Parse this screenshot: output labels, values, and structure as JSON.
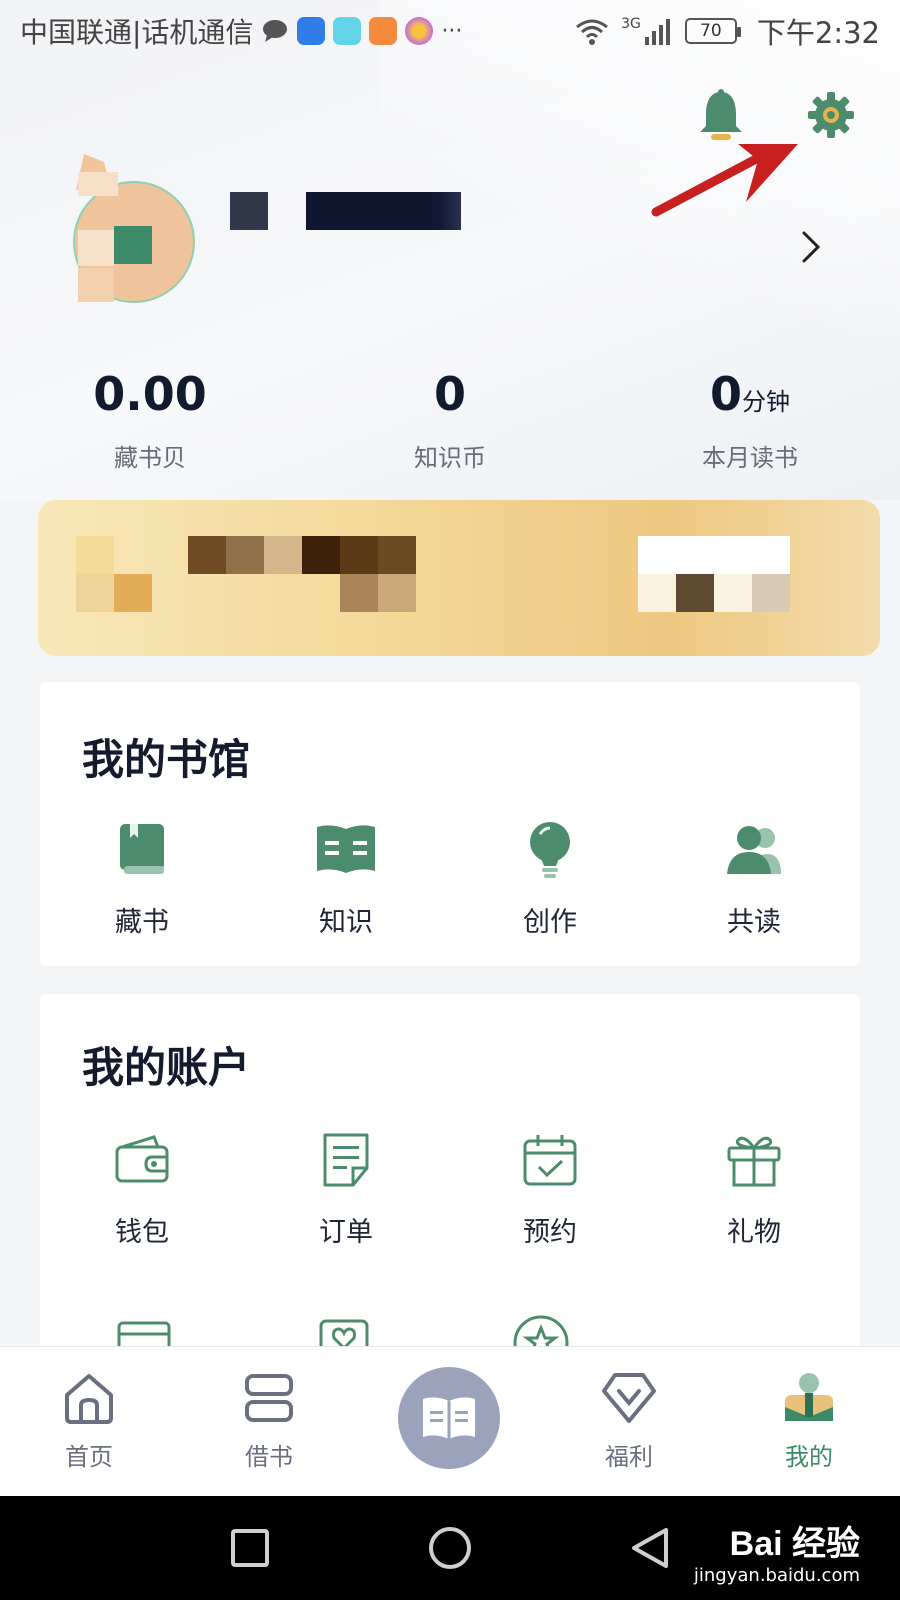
{
  "status_bar": {
    "carrier": "中国联通|话机通信",
    "more": "···",
    "network": "3G",
    "battery": "70",
    "time": "下午2:32"
  },
  "stats": [
    {
      "value": "0.00",
      "unit": "",
      "label": "藏书贝"
    },
    {
      "value": "0",
      "unit": "",
      "label": "知识币"
    },
    {
      "value": "0",
      "unit": "分钟",
      "label": "本月读书"
    }
  ],
  "library": {
    "title": "我的书馆",
    "items": [
      {
        "label": "藏书",
        "icon": "book-icon"
      },
      {
        "label": "知识",
        "icon": "open-book-icon"
      },
      {
        "label": "创作",
        "icon": "lightbulb-icon"
      },
      {
        "label": "共读",
        "icon": "users-icon"
      }
    ]
  },
  "account": {
    "title": "我的账户",
    "items": [
      {
        "label": "钱包",
        "icon": "wallet-icon"
      },
      {
        "label": "订单",
        "icon": "order-icon"
      },
      {
        "label": "预约",
        "icon": "calendar-check-icon"
      },
      {
        "label": "礼物",
        "icon": "gift-icon"
      }
    ]
  },
  "tabs": [
    {
      "label": "首页",
      "icon": "home-icon",
      "active": false
    },
    {
      "label": "借书",
      "icon": "borrow-icon",
      "active": false
    },
    {
      "label": "",
      "icon": "read-book-icon",
      "active": false
    },
    {
      "label": "福利",
      "icon": "diamond-icon",
      "active": false
    },
    {
      "label": "我的",
      "icon": "profile-icon",
      "active": true
    }
  ],
  "watermark": {
    "logo": "Bai 经验",
    "url": "jingyan.baidu.com"
  },
  "colors": {
    "accent": "#3c8a68",
    "icon_green": "#4c8c6c",
    "arrow_red": "#c8201e",
    "banner": "#f0cf8c"
  }
}
